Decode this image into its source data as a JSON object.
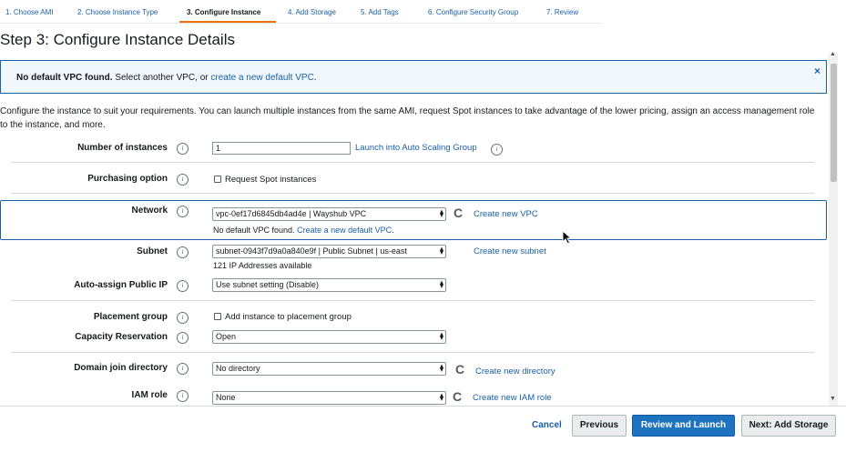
{
  "tabs": [
    "1. Choose AMI",
    "2. Choose Instance Type",
    "3. Configure Instance",
    "4. Add Storage",
    "5. Add Tags",
    "6. Configure Security Group",
    "7. Review"
  ],
  "page_title": "Step 3: Configure Instance Details",
  "alert": {
    "bold": "No default VPC found.",
    "text": " Select another VPC, or ",
    "link": "create a new default VPC",
    "suffix": ".",
    "close": "×"
  },
  "description": "Configure the instance to suit your requirements. You can launch multiple instances from the same AMI, request Spot instances to take advantage of the lower pricing, assign an access management role to the instance, and more.",
  "form": {
    "instances": {
      "label": "Number of instances",
      "value": "1",
      "link": "Launch into Auto Scaling Group"
    },
    "purchasing": {
      "label": "Purchasing option",
      "checkbox": "Request Spot instances"
    },
    "network": {
      "label": "Network",
      "value": "vpc-0ef17d6845db4ad4e | Wayshub VPC",
      "link": "Create new VPC",
      "warn_text": "No default VPC found.",
      "warn_link": "Create a new default VPC",
      "warn_suffix": "."
    },
    "subnet": {
      "label": "Subnet",
      "value": "subnet-0943f7d9a0a840e9f | Public Subnet | us-east",
      "link": "Create new subnet",
      "sub": "121 IP Addresses available"
    },
    "public_ip": {
      "label": "Auto-assign Public IP",
      "value": "Use subnet setting (Disable)"
    },
    "placement": {
      "label": "Placement group",
      "checkbox": "Add instance to placement group"
    },
    "capacity": {
      "label": "Capacity Reservation",
      "value": "Open"
    },
    "domain": {
      "label": "Domain join directory",
      "value": "No directory",
      "link": "Create new directory"
    },
    "iam": {
      "label": "IAM role",
      "value": "None",
      "link": "Create new IAM role"
    }
  },
  "footer": {
    "cancel": "Cancel",
    "previous": "Previous",
    "review": "Review and Launch",
    "next": "Next: Add Storage"
  },
  "icons": {
    "info": "i",
    "caret": "⧫",
    "refresh": "C"
  }
}
